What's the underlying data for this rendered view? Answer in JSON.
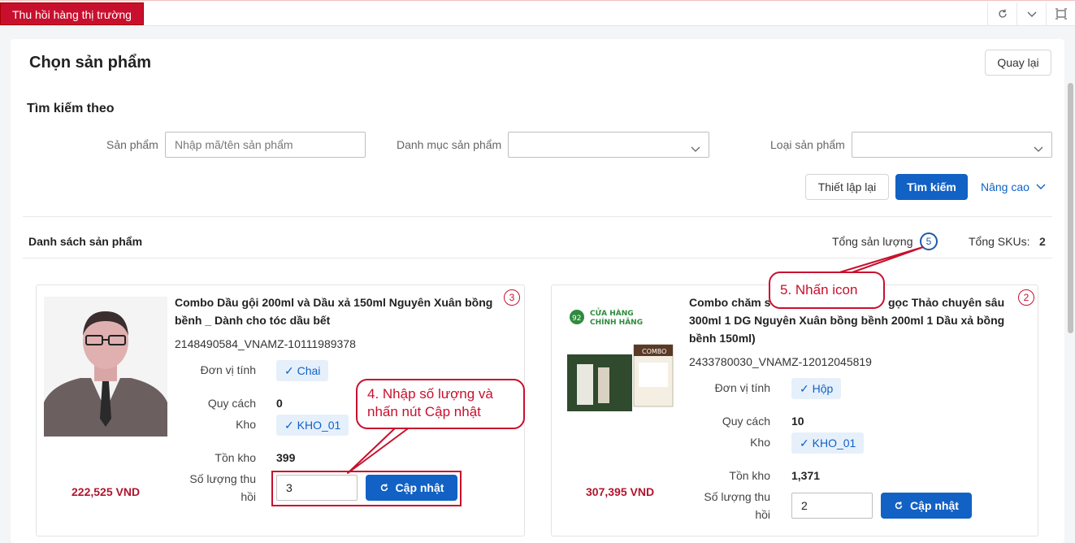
{
  "tab": {
    "label": "Thu hồi hàng thị trường"
  },
  "window_icons": [
    "refresh-icon",
    "chevron-down-icon",
    "fullscreen-icon"
  ],
  "page": {
    "title": "Chọn sản phẩm",
    "back_label": "Quay lại"
  },
  "search": {
    "section_title": "Tìm kiếm theo",
    "product_label": "Sản phẩm",
    "product_placeholder": "Nhập mã/tên sản phẩm",
    "category_label": "Danh mục sản phẩm",
    "type_label": "Loại sản phẩm",
    "reset_label": "Thiết lập lại",
    "search_label": "Tìm kiếm",
    "advanced_label": "Nâng cao"
  },
  "list": {
    "title": "Danh sách sản phẩm",
    "total_qty_label": "Tổng sản lượng",
    "total_qty_value": "5",
    "total_sku_label": "Tổng SKUs:",
    "total_sku_value": "2"
  },
  "products": [
    {
      "badge": "3",
      "name_line1": "Combo Dầu gội 200ml và Dầu xả 150ml Nguyên Xuân bồng",
      "name_line2": "bềnh _ Dành cho tóc dầu bết",
      "sku": "2148490584_VNAMZ-10111989378",
      "unit_label": "Đơn vị tính",
      "unit": "Chai",
      "spec_label": "Quy cách",
      "spec": "0",
      "warehouse_label": "Kho",
      "warehouse": "KHO_01",
      "stock_label": "Tồn kho",
      "stock": "399",
      "qty_label_1": "Số lượng thu",
      "qty_label_2": "hồi",
      "qty": "3",
      "price": "222,525 VND",
      "update_label": "Cập nhật"
    },
    {
      "badge": "2",
      "name_line1": "Combo chăm s",
      "name_line1_tail": "gọc Thảo chuyên sâu",
      "name_line2": "300ml 1 DG Nguyên Xuân bồng bềnh 200ml 1 Dầu xả bồng",
      "name_line3": "bềnh 150ml)",
      "sku": "2433780030_VNAMZ-12012045819",
      "unit_label": "Đơn vị tính",
      "unit": "Hộp",
      "spec_label": "Quy cách",
      "spec": "10",
      "warehouse_label": "Kho",
      "warehouse": "KHO_01",
      "stock_label": "Tồn kho",
      "stock": "1,371",
      "qty_label_1": "Số lượng thu",
      "qty_label_2": "hồi",
      "qty": "2",
      "price": "307,395 VND",
      "update_label": "Cập nhật",
      "image_text_1": "CỬA HÀNG",
      "image_text_2": "CHÍNH HÃNG",
      "image_text_3": "COMBO"
    }
  ],
  "annotations": {
    "step4_line1": "4. Nhập số lượng và",
    "step4_line2": "nhấn nút Cập nhật",
    "step5": "5. Nhấn icon"
  },
  "colors": {
    "brand_red": "#c8102e",
    "primary_blue": "#1261c4",
    "price_red": "#b0152e"
  }
}
